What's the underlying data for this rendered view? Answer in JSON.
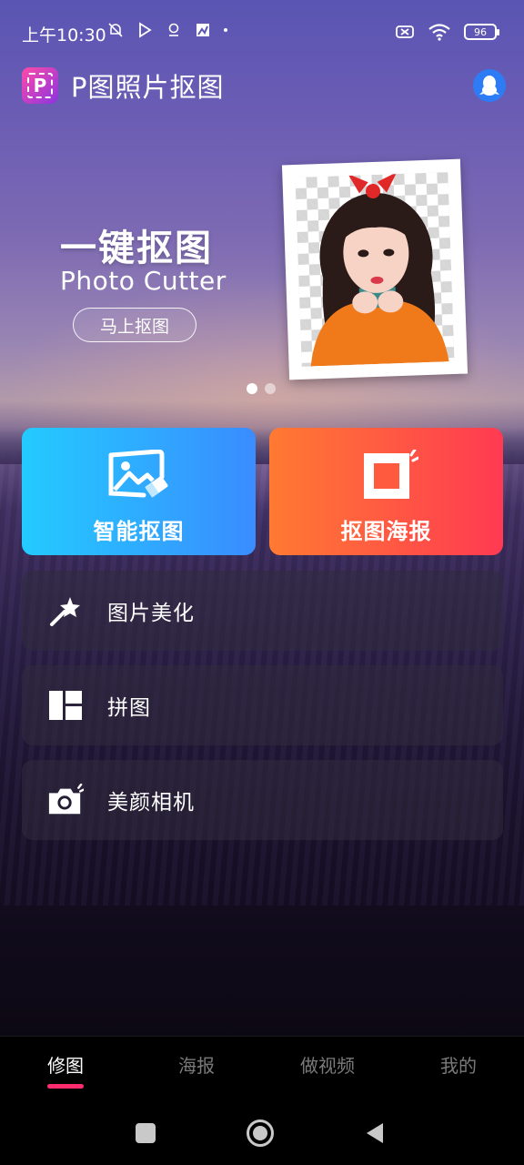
{
  "status_bar": {
    "time": "上午10:30",
    "battery": "96",
    "icons_left": [
      "notification-off-icon",
      "play-store-icon",
      "location-icon",
      "app-icon",
      "dot-icon"
    ],
    "icons_right": [
      "sim-off-icon",
      "wifi-icon",
      "battery-icon"
    ]
  },
  "header": {
    "logo_letter": "P",
    "title": "P图照片抠图",
    "qq_icon": "qq-penguin-icon"
  },
  "banner": {
    "title": "一键抠图",
    "subtitle": "Photo Cutter",
    "button_label": "马上抠图",
    "pages": 2,
    "active_page": 1
  },
  "cards": {
    "cutout": {
      "label": "智能抠图",
      "icon": "image-erase-icon",
      "gradient": [
        "#23cbff",
        "#3a8cff"
      ]
    },
    "poster": {
      "label": "抠图海报",
      "icon": "frame-sparkle-icon",
      "gradient": [
        "#ff7a32",
        "#ff3a52"
      ]
    }
  },
  "list": {
    "beautify": {
      "label": "图片美化",
      "icon": "magic-wand-icon"
    },
    "collage": {
      "label": "拼图",
      "icon": "collage-layout-icon"
    },
    "camera": {
      "label": "美颜相机",
      "icon": "camera-icon"
    }
  },
  "bottom_nav": {
    "tabs": [
      {
        "label": "修图",
        "active": true
      },
      {
        "label": "海报",
        "active": false
      },
      {
        "label": "做视频",
        "active": false
      },
      {
        "label": "我的",
        "active": false
      }
    ],
    "accent": "#ff2d6e"
  },
  "system_nav": {
    "buttons": [
      "recents-square-icon",
      "home-circle-icon",
      "back-triangle-icon"
    ]
  }
}
